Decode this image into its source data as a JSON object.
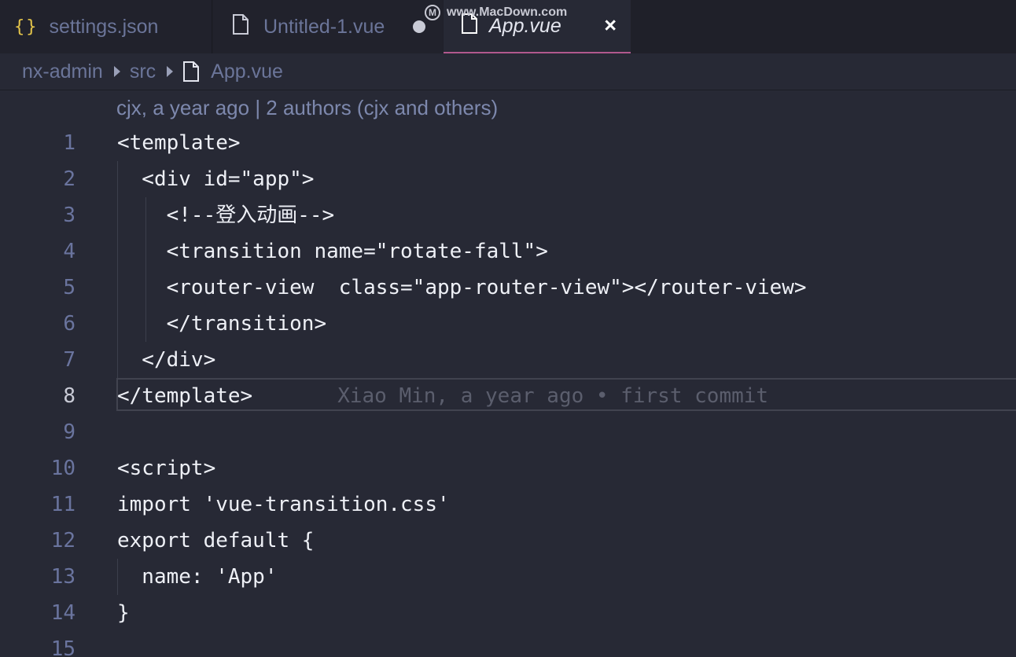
{
  "tabs": [
    {
      "label": "settings.json",
      "icon": "json-braces-icon"
    },
    {
      "label": "Untitled-1.vue",
      "icon": "file-icon",
      "dirty": true
    },
    {
      "label": "App.vue",
      "icon": "file-icon",
      "active": true,
      "close": "×"
    }
  ],
  "watermark": {
    "logo": "M",
    "text": "www.MacDown.com"
  },
  "breadcrumb": [
    "nx-admin",
    "src",
    "App.vue"
  ],
  "codelens": "cjx, a year ago | 2 authors (cjx and others)",
  "blame": "Xiao Min, a year ago • first commit",
  "active_line": 8,
  "lines": [
    {
      "n": "1",
      "text": "<template>"
    },
    {
      "n": "2",
      "text": "  <div id=\"app\">"
    },
    {
      "n": "3",
      "text": "    <!--登入动画-->"
    },
    {
      "n": "4",
      "text": "    <transition name=\"rotate-fall\">"
    },
    {
      "n": "5",
      "text": "    <router-view  class=\"app-router-view\"></router-view>"
    },
    {
      "n": "6",
      "text": "    </transition>"
    },
    {
      "n": "7",
      "text": "  </div>"
    },
    {
      "n": "8",
      "text": "</template>"
    },
    {
      "n": "9",
      "text": ""
    },
    {
      "n": "10",
      "text": "<script>"
    },
    {
      "n": "11",
      "text": "import 'vue-transition.css'"
    },
    {
      "n": "12",
      "text": "export default {"
    },
    {
      "n": "13",
      "text": "  name: 'App'"
    },
    {
      "n": "14",
      "text": "}"
    },
    {
      "n": "15",
      "text": ""
    }
  ],
  "colors": {
    "accent": "#b1588d",
    "json_icon": "#e3c44a",
    "background": "#272935"
  }
}
